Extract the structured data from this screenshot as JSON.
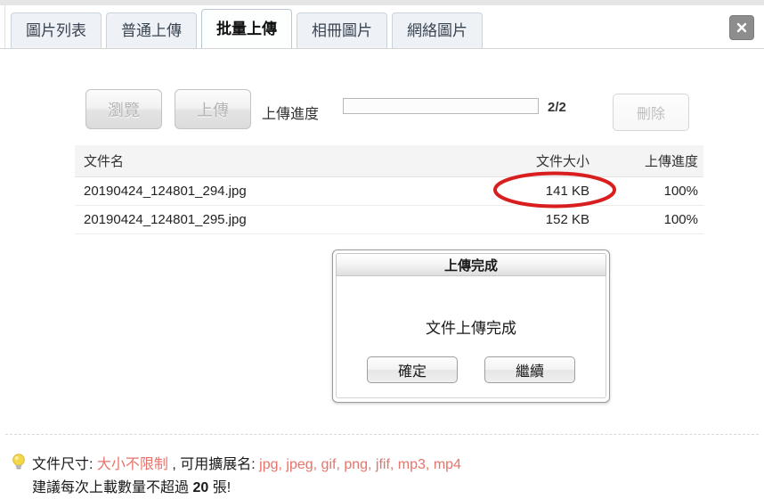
{
  "window": {
    "close_label": "×",
    "close_icon": "close-icon"
  },
  "tabs": [
    {
      "label": "圖片列表",
      "active": false
    },
    {
      "label": "普通上傳",
      "active": false
    },
    {
      "label": "批量上傳",
      "active": true
    },
    {
      "label": "相冊圖片",
      "active": false
    },
    {
      "label": "網絡圖片",
      "active": false
    }
  ],
  "toolbar": {
    "browse_label": "瀏覽",
    "upload_label": "上傳",
    "progress_label": "上傳進度",
    "progress_count": "2/2",
    "progress_percent": 0,
    "delete_label": "刪除"
  },
  "table": {
    "headers": {
      "name": "文件名",
      "size": "文件大小",
      "progress": "上傳進度"
    },
    "rows": [
      {
        "name": "20190424_124801_294.jpg",
        "size": "141 KB",
        "progress": "100%"
      },
      {
        "name": "20190424_124801_295.jpg",
        "size": "152 KB",
        "progress": "100%"
      }
    ]
  },
  "annotation": {
    "shape": "ellipse",
    "color": "#d81e1e",
    "targets": "141 KB"
  },
  "dialog": {
    "title": "上傳完成",
    "message": "文件上傳完成",
    "confirm_label": "確定",
    "continue_label": "繼續"
  },
  "footer": {
    "icon": "lightbulb-icon",
    "line1_prefix": "文件尺寸: ",
    "line1_size_limit": "大小不限制",
    "line1_middle": " , 可用擴展名: ",
    "line1_extensions": "jpg, jpeg, gif, png, jfif, mp3, mp4",
    "line2_prefix": "建議每次上載數量不超過 ",
    "line2_count": "20",
    "line2_suffix": " 張!"
  },
  "colors": {
    "accent_red": "#e8736b",
    "annotation_red": "#d81e1e",
    "tab_inactive_bg": "#eef2f7",
    "tab_active_bg": "#fdfefe"
  }
}
